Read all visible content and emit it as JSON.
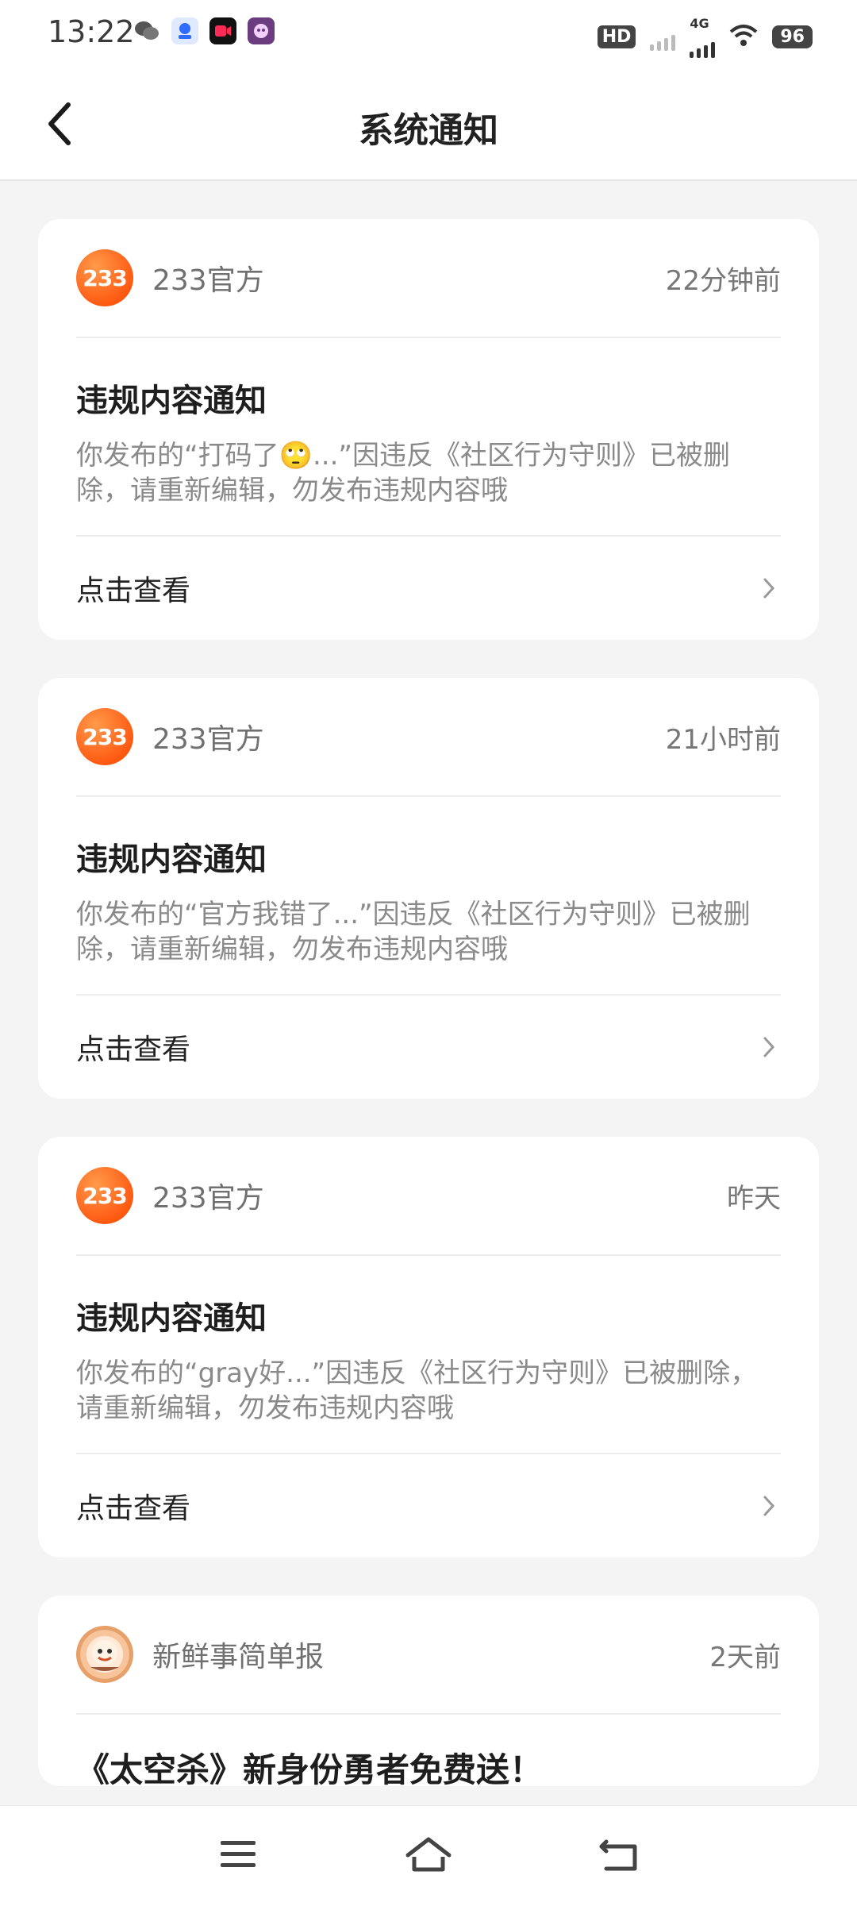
{
  "status_bar": {
    "time": "13:22",
    "battery": "96",
    "network": "4G",
    "hd": "HD"
  },
  "header": {
    "title": "系统通知"
  },
  "notifications": [
    {
      "sender": "233官方",
      "avatar_text": "233",
      "time": "22分钟前",
      "title": "违规内容通知",
      "text": "你发布的“打码了🙄...”因违反《社区行为守则》已被删除，请重新编辑，勿发布违规内容哦",
      "action": "点击查看"
    },
    {
      "sender": "233官方",
      "avatar_text": "233",
      "time": "21小时前",
      "title": "违规内容通知",
      "text": "你发布的“官方我错了...”因违反《社区行为守则》已被删除，请重新编辑，勿发布违规内容哦",
      "action": "点击查看"
    },
    {
      "sender": "233官方",
      "avatar_text": "233",
      "time": "昨天",
      "title": "违规内容通知",
      "text": "你发布的“gray好...”因违反《社区行为守则》已被删除，请重新编辑，勿发布违规内容哦",
      "action": "点击查看"
    },
    {
      "sender": "新鲜事简单报",
      "time": "2天前",
      "title": "《太空杀》新身份勇者免费送！"
    }
  ],
  "nav": {
    "menu_icon": "menu-icon",
    "home_icon": "home-icon",
    "back_icon": "back-icon"
  },
  "colors": {
    "background": "#f4f4f4",
    "card": "#ffffff",
    "avatar_orange": "#ff5a12"
  }
}
